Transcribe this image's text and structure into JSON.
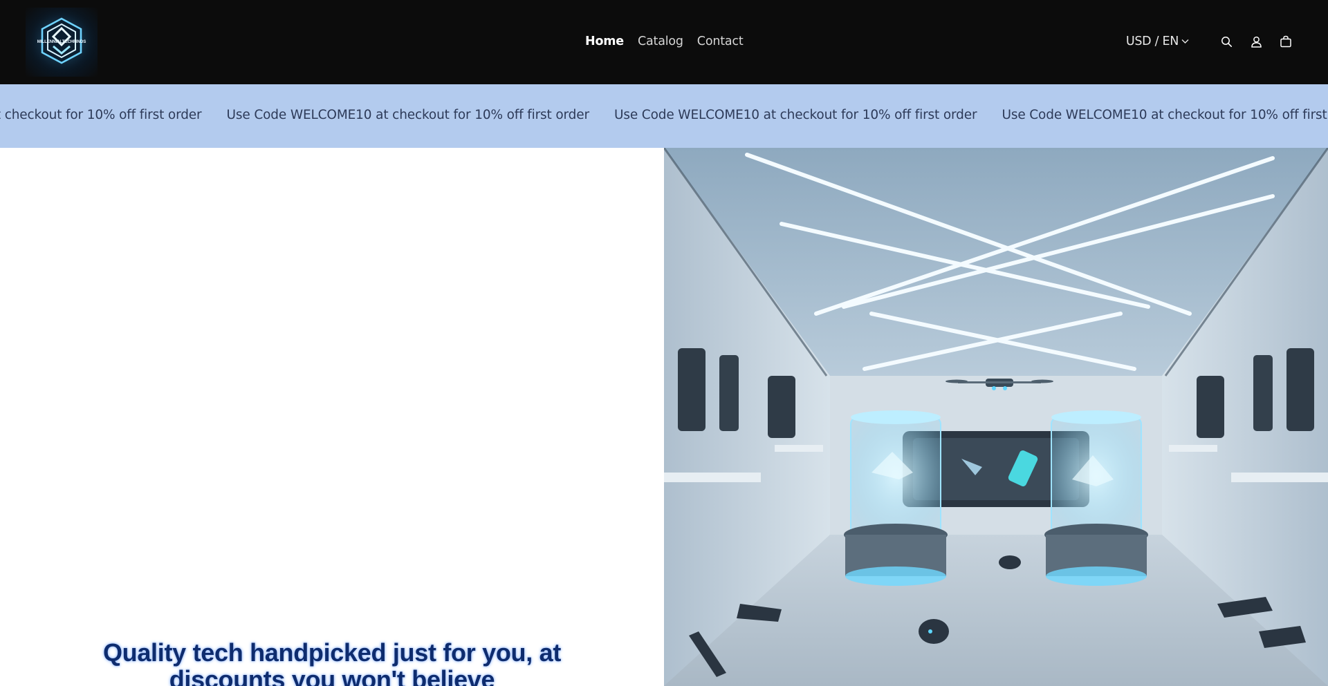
{
  "header": {
    "logo_text": "MILLENNIALTECHFINDS",
    "nav": [
      {
        "label": "Home",
        "active": true
      },
      {
        "label": "Catalog",
        "active": false
      },
      {
        "label": "Contact",
        "active": false
      }
    ],
    "locale": "USD / EN",
    "icons": [
      "search-icon",
      "account-icon",
      "cart-icon"
    ]
  },
  "announcement": {
    "text": "Use Code WELCOME10 at checkout for 10% off first order",
    "color_bg": "#b3cbee"
  },
  "hero": {
    "title": "Quality tech handpicked just for you, at discounts you won't believe",
    "image_alt": "futuristic-tech-showroom"
  },
  "colors": {
    "header_bg": "#0c0c0c",
    "title_color": "#0e2c6e"
  }
}
